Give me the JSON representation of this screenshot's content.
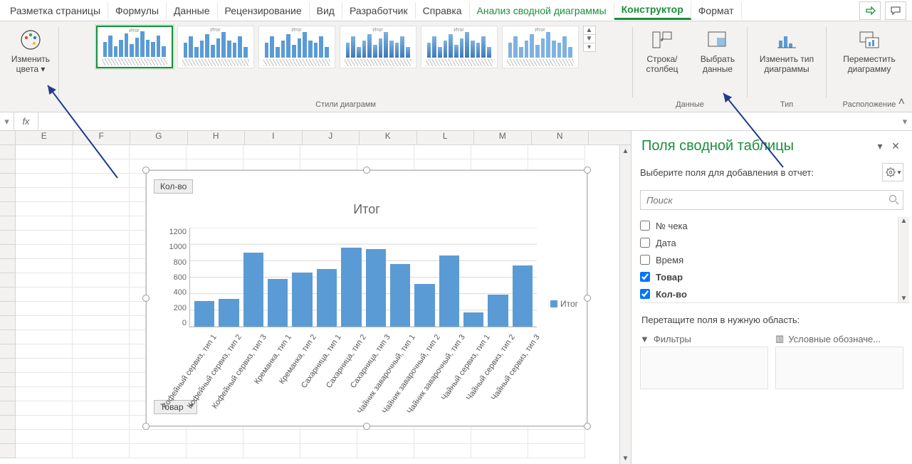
{
  "tabs": {
    "t1": "Разметка страницы",
    "t2": "Формулы",
    "t3": "Данные",
    "t4": "Рецензирование",
    "t5": "Вид",
    "t6": "Разработчик",
    "t7": "Справка",
    "t8": "Анализ сводной диаграммы",
    "t9": "Конструктор",
    "t10": "Формат"
  },
  "ribbon": {
    "change_colors_l1": "Изменить",
    "change_colors_l2": "цвета",
    "styles_group": "Стили диаграмм",
    "switch_rc_l1": "Строка/",
    "switch_rc_l2": "столбец",
    "select_data_l1": "Выбрать",
    "select_data_l2": "данные",
    "data_group": "Данные",
    "change_type_l1": "Изменить тип",
    "change_type_l2": "диаграммы",
    "type_group": "Тип",
    "move_chart_l1": "Переместить",
    "move_chart_l2": "диаграмму",
    "location_group": "Расположение",
    "thumb_title": "Итог"
  },
  "formula_bar": {
    "fx": "fx"
  },
  "columns": [
    "E",
    "F",
    "G",
    "H",
    "I",
    "J",
    "K",
    "L",
    "M",
    "N"
  ],
  "chart_ui": {
    "btn_qty": "Кол-во",
    "btn_goods": "Товар",
    "title": "Итог",
    "legend": "Итог"
  },
  "chart_data": {
    "type": "bar",
    "title": "Итог",
    "ylabel": "",
    "xlabel": "",
    "ylim": [
      0,
      1200
    ],
    "yticks": [
      0,
      200,
      400,
      600,
      800,
      1000,
      1200
    ],
    "categories": [
      "Кофейный сервиз, тип 1",
      "Кофейный сервиз, тип 2",
      "Кофейный сервиз, тип 3",
      "Креманка, тип 1",
      "Креманка, тип 2",
      "Сахарница, тип 1",
      "Сахарница, тип 2",
      "Сахарница, тип 3",
      "Чайник заварочный, тип 1",
      "Чайник заварочный, тип 2",
      "Чайник заварочный, тип 3",
      "Чайный сервиз, тип 1",
      "Чайный сервиз, тип 2",
      "Чайный сервиз, тип 3"
    ],
    "values": [
      310,
      340,
      900,
      580,
      660,
      700,
      960,
      940,
      760,
      520,
      860,
      170,
      390,
      740
    ],
    "legend": "Итог"
  },
  "pane": {
    "title": "Поля сводной таблицы",
    "subtitle": "Выберите поля для добавления в отчет:",
    "search_placeholder": "Поиск",
    "fields": {
      "f1": "№ чека",
      "f2": "Дата",
      "f3": "Время",
      "f4": "Товар",
      "f5": "Кол-во"
    },
    "drag_label": "Перетащите поля в нужную область:",
    "filters_title": "Фильтры",
    "legends_title": "Условные обозначе..."
  }
}
